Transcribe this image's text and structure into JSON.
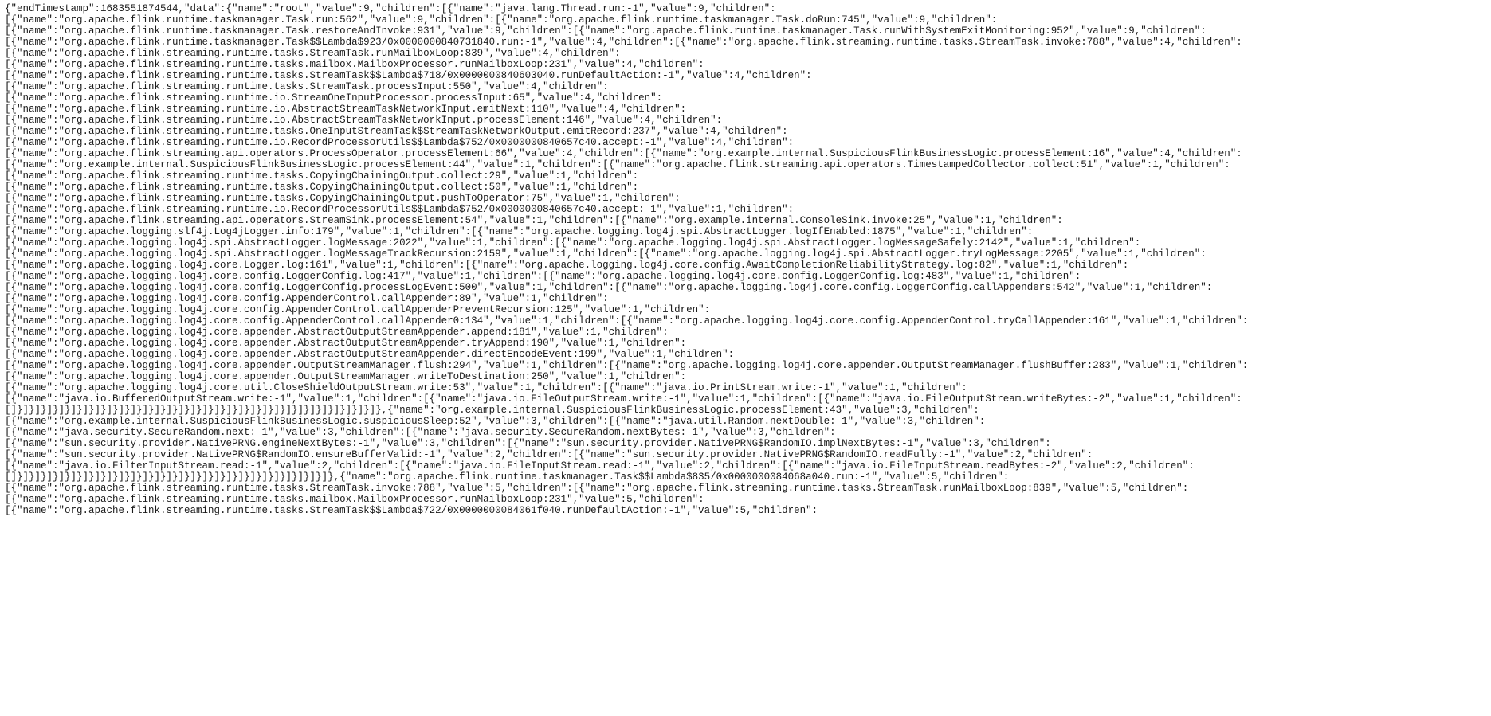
{
  "lines": [
    "{\"endTimestamp\":1683551874544,\"data\":{\"name\":\"root\",\"value\":9,\"children\":[{\"name\":\"java.lang.Thread.run:-1\",\"value\":9,\"children\":",
    "[{\"name\":\"org.apache.flink.runtime.taskmanager.Task.run:562\",\"value\":9,\"children\":[{\"name\":\"org.apache.flink.runtime.taskmanager.Task.doRun:745\",\"value\":9,\"children\":",
    "[{\"name\":\"org.apache.flink.runtime.taskmanager.Task.restoreAndInvoke:931\",\"value\":9,\"children\":[{\"name\":\"org.apache.flink.runtime.taskmanager.Task.runWithSystemExitMonitoring:952\",\"value\":9,\"children\":",
    "[{\"name\":\"org.apache.flink.runtime.taskmanager.Task$$Lambda$923/0x0000000840731840.run:-1\",\"value\":4,\"children\":[{\"name\":\"org.apache.flink.streaming.runtime.tasks.StreamTask.invoke:788\",\"value\":4,\"children\":",
    "[{\"name\":\"org.apache.flink.streaming.runtime.tasks.StreamTask.runMailboxLoop:839\",\"value\":4,\"children\":",
    "[{\"name\":\"org.apache.flink.streaming.runtime.tasks.mailbox.MailboxProcessor.runMailboxLoop:231\",\"value\":4,\"children\":",
    "[{\"name\":\"org.apache.flink.streaming.runtime.tasks.StreamTask$$Lambda$718/0x0000000840603040.runDefaultAction:-1\",\"value\":4,\"children\":",
    "[{\"name\":\"org.apache.flink.streaming.runtime.tasks.StreamTask.processInput:550\",\"value\":4,\"children\":",
    "[{\"name\":\"org.apache.flink.streaming.runtime.io.StreamOneInputProcessor.processInput:65\",\"value\":4,\"children\":",
    "[{\"name\":\"org.apache.flink.streaming.runtime.io.AbstractStreamTaskNetworkInput.emitNext:110\",\"value\":4,\"children\":",
    "[{\"name\":\"org.apache.flink.streaming.runtime.io.AbstractStreamTaskNetworkInput.processElement:146\",\"value\":4,\"children\":",
    "[{\"name\":\"org.apache.flink.streaming.runtime.tasks.OneInputStreamTask$StreamTaskNetworkOutput.emitRecord:237\",\"value\":4,\"children\":",
    "[{\"name\":\"org.apache.flink.streaming.runtime.io.RecordProcessorUtils$$Lambda$752/0x0000000840657c40.accept:-1\",\"value\":4,\"children\":",
    "[{\"name\":\"org.apache.flink.streaming.api.operators.ProcessOperator.processElement:66\",\"value\":4,\"children\":[{\"name\":\"org.example.internal.SuspiciousFlinkBusinessLogic.processElement:16\",\"value\":4,\"children\":",
    "[{\"name\":\"org.example.internal.SuspiciousFlinkBusinessLogic.processElement:44\",\"value\":1,\"children\":[{\"name\":\"org.apache.flink.streaming.api.operators.TimestampedCollector.collect:51\",\"value\":1,\"children\":",
    "[{\"name\":\"org.apache.flink.streaming.runtime.tasks.CopyingChainingOutput.collect:29\",\"value\":1,\"children\":",
    "[{\"name\":\"org.apache.flink.streaming.runtime.tasks.CopyingChainingOutput.collect:50\",\"value\":1,\"children\":",
    "[{\"name\":\"org.apache.flink.streaming.runtime.tasks.CopyingChainingOutput.pushToOperator:75\",\"value\":1,\"children\":",
    "[{\"name\":\"org.apache.flink.streaming.runtime.io.RecordProcessorUtils$$Lambda$752/0x0000000840657c40.accept:-1\",\"value\":1,\"children\":",
    "[{\"name\":\"org.apache.flink.streaming.api.operators.StreamSink.processElement:54\",\"value\":1,\"children\":[{\"name\":\"org.example.internal.ConsoleSink.invoke:25\",\"value\":1,\"children\":",
    "[{\"name\":\"org.apache.logging.slf4j.Log4jLogger.info:179\",\"value\":1,\"children\":[{\"name\":\"org.apache.logging.log4j.spi.AbstractLogger.logIfEnabled:1875\",\"value\":1,\"children\":",
    "[{\"name\":\"org.apache.logging.log4j.spi.AbstractLogger.logMessage:2022\",\"value\":1,\"children\":[{\"name\":\"org.apache.logging.log4j.spi.AbstractLogger.logMessageSafely:2142\",\"value\":1,\"children\":",
    "[{\"name\":\"org.apache.logging.log4j.spi.AbstractLogger.logMessageTrackRecursion:2159\",\"value\":1,\"children\":[{\"name\":\"org.apache.logging.log4j.spi.AbstractLogger.tryLogMessage:2205\",\"value\":1,\"children\":",
    "[{\"name\":\"org.apache.logging.log4j.core.Logger.log:161\",\"value\":1,\"children\":[{\"name\":\"org.apache.logging.log4j.core.config.AwaitCompletionReliabilityStrategy.log:82\",\"value\":1,\"children\":",
    "[{\"name\":\"org.apache.logging.log4j.core.config.LoggerConfig.log:417\",\"value\":1,\"children\":[{\"name\":\"org.apache.logging.log4j.core.config.LoggerConfig.log:483\",\"value\":1,\"children\":",
    "[{\"name\":\"org.apache.logging.log4j.core.config.LoggerConfig.processLogEvent:500\",\"value\":1,\"children\":[{\"name\":\"org.apache.logging.log4j.core.config.LoggerConfig.callAppenders:542\",\"value\":1,\"children\":",
    "[{\"name\":\"org.apache.logging.log4j.core.config.AppenderControl.callAppender:89\",\"value\":1,\"children\":",
    "[{\"name\":\"org.apache.logging.log4j.core.config.AppenderControl.callAppenderPreventRecursion:125\",\"value\":1,\"children\":",
    "[{\"name\":\"org.apache.logging.log4j.core.config.AppenderControl.callAppender0:134\",\"value\":1,\"children\":[{\"name\":\"org.apache.logging.log4j.core.config.AppenderControl.tryCallAppender:161\",\"value\":1,\"children\":",
    "[{\"name\":\"org.apache.logging.log4j.core.appender.AbstractOutputStreamAppender.append:181\",\"value\":1,\"children\":",
    "[{\"name\":\"org.apache.logging.log4j.core.appender.AbstractOutputStreamAppender.tryAppend:190\",\"value\":1,\"children\":",
    "[{\"name\":\"org.apache.logging.log4j.core.appender.AbstractOutputStreamAppender.directEncodeEvent:199\",\"value\":1,\"children\":",
    "[{\"name\":\"org.apache.logging.log4j.core.appender.OutputStreamManager.flush:294\",\"value\":1,\"children\":[{\"name\":\"org.apache.logging.log4j.core.appender.OutputStreamManager.flushBuffer:283\",\"value\":1,\"children\":",
    "[{\"name\":\"org.apache.logging.log4j.core.appender.OutputStreamManager.writeToDestination:250\",\"value\":1,\"children\":",
    "[{\"name\":\"org.apache.logging.log4j.core.util.CloseShieldOutputStream.write:53\",\"value\":1,\"children\":[{\"name\":\"java.io.PrintStream.write:-1\",\"value\":1,\"children\":",
    "[{\"name\":\"java.io.BufferedOutputStream.write:-1\",\"value\":1,\"children\":[{\"name\":\"java.io.FileOutputStream.write:-1\",\"value\":1,\"children\":[{\"name\":\"java.io.FileOutputStream.writeBytes:-2\",\"value\":1,\"children\":",
    "[]}]}]}]}]}]}]}]}]}]}]}]}]}]}]}]}]}]}]}]}]}]}]}]}]}]}]}]}]}]}]},{\"name\":\"org.example.internal.SuspiciousFlinkBusinessLogic.processElement:43\",\"value\":3,\"children\":",
    "[{\"name\":\"org.example.internal.SuspiciousFlinkBusinessLogic.suspiciousSleep:52\",\"value\":3,\"children\":[{\"name\":\"java.util.Random.nextDouble:-1\",\"value\":3,\"children\":",
    "[{\"name\":\"java.security.SecureRandom.next:-1\",\"value\":3,\"children\":[{\"name\":\"java.security.SecureRandom.nextBytes:-1\",\"value\":3,\"children\":",
    "[{\"name\":\"sun.security.provider.NativePRNG.engineNextBytes:-1\",\"value\":3,\"children\":[{\"name\":\"sun.security.provider.NativePRNG$RandomIO.implNextBytes:-1\",\"value\":3,\"children\":",
    "[{\"name\":\"sun.security.provider.NativePRNG$RandomIO.ensureBufferValid:-1\",\"value\":2,\"children\":[{\"name\":\"sun.security.provider.NativePRNG$RandomIO.readFully:-1\",\"value\":2,\"children\":",
    "[{\"name\":\"java.io.FilterInputStream.read:-1\",\"value\":2,\"children\":[{\"name\":\"java.io.FileInputStream.read:-1\",\"value\":2,\"children\":[{\"name\":\"java.io.FileInputStream.readBytes:-2\",\"value\":2,\"children\":",
    "[]}]}]}]}]}]}]}]}]}]}]}]}]}]}]}]}]}]}]}]}]}]}]}]}]}]}]},{\"name\":\"org.apache.flink.runtime.taskmanager.Task$$Lambda$835/0x0000000084068a040.run:-1\",\"value\":5,\"children\":",
    "[{\"name\":\"org.apache.flink.streaming.runtime.tasks.StreamTask.invoke:788\",\"value\":5,\"children\":[{\"name\":\"org.apache.flink.streaming.runtime.tasks.StreamTask.runMailboxLoop:839\",\"value\":5,\"children\":",
    "[{\"name\":\"org.apache.flink.streaming.runtime.tasks.mailbox.MailboxProcessor.runMailboxLoop:231\",\"value\":5,\"children\":",
    "[{\"name\":\"org.apache.flink.streaming.runtime.tasks.StreamTask$$Lambda$722/0x0000000084061f040.runDefaultAction:-1\",\"value\":5,\"children\":"
  ]
}
